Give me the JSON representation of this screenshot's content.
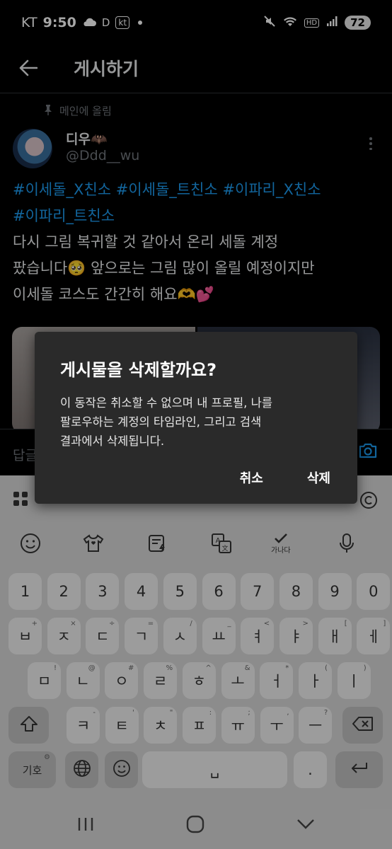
{
  "status_bar": {
    "carrier": "KT",
    "time": "9:50",
    "d_label": "D",
    "kt_badge": "kt",
    "hd_label": "HD",
    "battery": "72"
  },
  "header": {
    "title": "게시하기"
  },
  "post": {
    "pinned_label": "메인에 올림",
    "user_name": "디우🦇",
    "user_handle": "@Ddd__wu",
    "hashtags_line1": "#이세돌_X친소 #이세돌_트친소 #이파리_X친소",
    "hashtags_line2": "#이파리_트친소",
    "body_line1": "다시 그림 복귀할 것 같아서 온리 세돌 계정",
    "body_line2": "팠습니다🥺 앞으로는 그림 많이 올릴 예정이지만",
    "body_line3": "이세돌 코스도 간간히 해요🫶💕"
  },
  "reply": {
    "placeholder": "답글"
  },
  "dialog": {
    "title": "게시물을 삭제할까요?",
    "body_line1": "이 동작은 취소할 수 없으며 내 프로필, 나를",
    "body_line2": "팔로우하는 계정의 타임라인, 그리고 검색",
    "body_line3": "결과에서 삭제됩니다.",
    "cancel_label": "취소",
    "delete_label": "삭제"
  },
  "keyboard": {
    "spell_check_label": "가나다",
    "row_numbers": [
      "1",
      "2",
      "3",
      "4",
      "5",
      "6",
      "7",
      "8",
      "9",
      "0"
    ],
    "row1": [
      {
        "k": "ㅂ",
        "h": "+"
      },
      {
        "k": "ㅈ",
        "h": "×"
      },
      {
        "k": "ㄷ",
        "h": "÷"
      },
      {
        "k": "ㄱ",
        "h": "="
      },
      {
        "k": "ㅅ",
        "h": "/"
      },
      {
        "k": "ㅛ",
        "h": "_"
      },
      {
        "k": "ㅕ",
        "h": "<"
      },
      {
        "k": "ㅑ",
        "h": ">"
      },
      {
        "k": "ㅐ",
        "h": "["
      },
      {
        "k": "ㅔ",
        "h": "]"
      }
    ],
    "row2": [
      {
        "k": "ㅁ",
        "h": "!"
      },
      {
        "k": "ㄴ",
        "h": "@"
      },
      {
        "k": "ㅇ",
        "h": "#"
      },
      {
        "k": "ㄹ",
        "h": "%"
      },
      {
        "k": "ㅎ",
        "h": "^"
      },
      {
        "k": "ㅗ",
        "h": "&"
      },
      {
        "k": "ㅓ",
        "h": "*"
      },
      {
        "k": "ㅏ",
        "h": "("
      },
      {
        "k": "ㅣ",
        "h": ")"
      }
    ],
    "row3": [
      {
        "k": "ㅋ",
        "h": "-"
      },
      {
        "k": "ㅌ",
        "h": "'"
      },
      {
        "k": "ㅊ",
        "h": "\""
      },
      {
        "k": "ㅍ",
        "h": ":"
      },
      {
        "k": "ㅠ",
        "h": ";"
      },
      {
        "k": "ㅜ",
        "h": ","
      },
      {
        "k": "ㅡ",
        "h": "?"
      }
    ],
    "symbols_label": "기호",
    "space_label": "␣",
    "period_label": ".",
    "shift_icon": "shift-icon",
    "backspace_icon": "backspace-icon",
    "enter_icon": "enter-icon"
  },
  "colors": {
    "background": "#000000",
    "hashtag": "#1d9bf0",
    "dialog_bg": "#2a2a2a",
    "keyboard_bg": "#d8d8d8"
  }
}
